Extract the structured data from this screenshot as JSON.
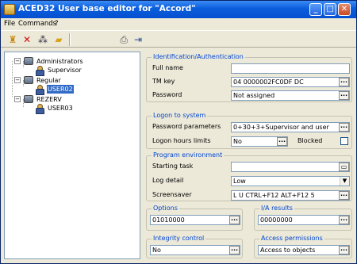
{
  "window": {
    "title": "ACED32 User base editor for \"Accord\""
  },
  "menu": {
    "file": "File",
    "commands": "Commands",
    "help": "?"
  },
  "toolbar": [
    "new-user-icon",
    "delete-icon",
    "add-group-icon",
    "open-folder-icon",
    "print-icon",
    "login-icon"
  ],
  "tree": {
    "administrators": "Administrators",
    "supervisor": "Supervisor",
    "regular": "Regular",
    "user02": "USER02",
    "rezerv": "REZERV",
    "user03": "USER03"
  },
  "ident": {
    "legend": "Identification/Authentication",
    "full_name_label": "Full name",
    "full_name_value": "",
    "tm_key_label": "TM key",
    "tm_key_value": "04 0000002FC0DF DC",
    "password_label": "Password",
    "password_value": "Not assigned"
  },
  "logon": {
    "legend": "Logon to system",
    "params_label": "Password parameters",
    "params_value": "0+30+3+Supervisor and user",
    "hours_label": "Logon hours limits",
    "hours_value": "No",
    "blocked_label": "Blocked"
  },
  "program": {
    "legend": "Program environment",
    "start_label": "Starting task",
    "start_value": "",
    "log_label": "Log detail",
    "log_value": "Low",
    "screensaver_label": "Screensaver",
    "screensaver_value": "L U CTRL+F12 ALT+F12 5"
  },
  "options": {
    "legend": "Options",
    "value": "01010000"
  },
  "ia_results": {
    "legend": "I/A results",
    "value": "00000000"
  },
  "integrity": {
    "legend": "Integrity control",
    "value": "No"
  },
  "access": {
    "legend": "Access permissions",
    "value": "Access to objects"
  },
  "colors": {
    "title_bar": "#0550d0",
    "selection": "#316ac5",
    "group_legend": "#0046d5"
  }
}
